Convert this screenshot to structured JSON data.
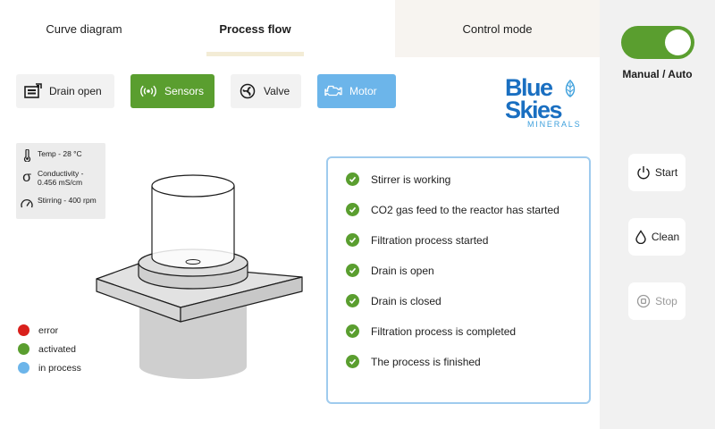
{
  "tabs": {
    "curve": "Curve diagram",
    "process": "Process flow",
    "control": "Control mode"
  },
  "actions": {
    "drain": "Drain open",
    "sensors": "Sensors",
    "valve": "Valve",
    "motor": "Motor"
  },
  "logo": {
    "line1": "Blue",
    "line2": "Skies",
    "line3": "MINERALS"
  },
  "sensors": {
    "temp": "Temp - 28 °C",
    "conductivity": "Conductivity - 0.456 mS/cm",
    "stirring": "Stirring - 400 rpm",
    "conductivity_symbol": "σ"
  },
  "legend": [
    {
      "label": "error",
      "color": "#d9201c"
    },
    {
      "label": "activated",
      "color": "#5a9e2f"
    },
    {
      "label": "in process",
      "color": "#6cb5ea"
    }
  ],
  "status": [
    "Stirrer is working",
    "CO2 gas feed to the reactor has started",
    "Filtration process started",
    "Drain is open",
    "Drain is closed",
    "Filtration process is completed",
    "The process is finished"
  ],
  "side": {
    "mode_label": "Manual / Auto",
    "mode_on": true,
    "start": "Start",
    "clean": "Clean",
    "stop": "Stop"
  },
  "colors": {
    "accent_green": "#5a9e2f",
    "accent_blue": "#6cb5ea",
    "brand_blue": "#1a6fc1"
  }
}
